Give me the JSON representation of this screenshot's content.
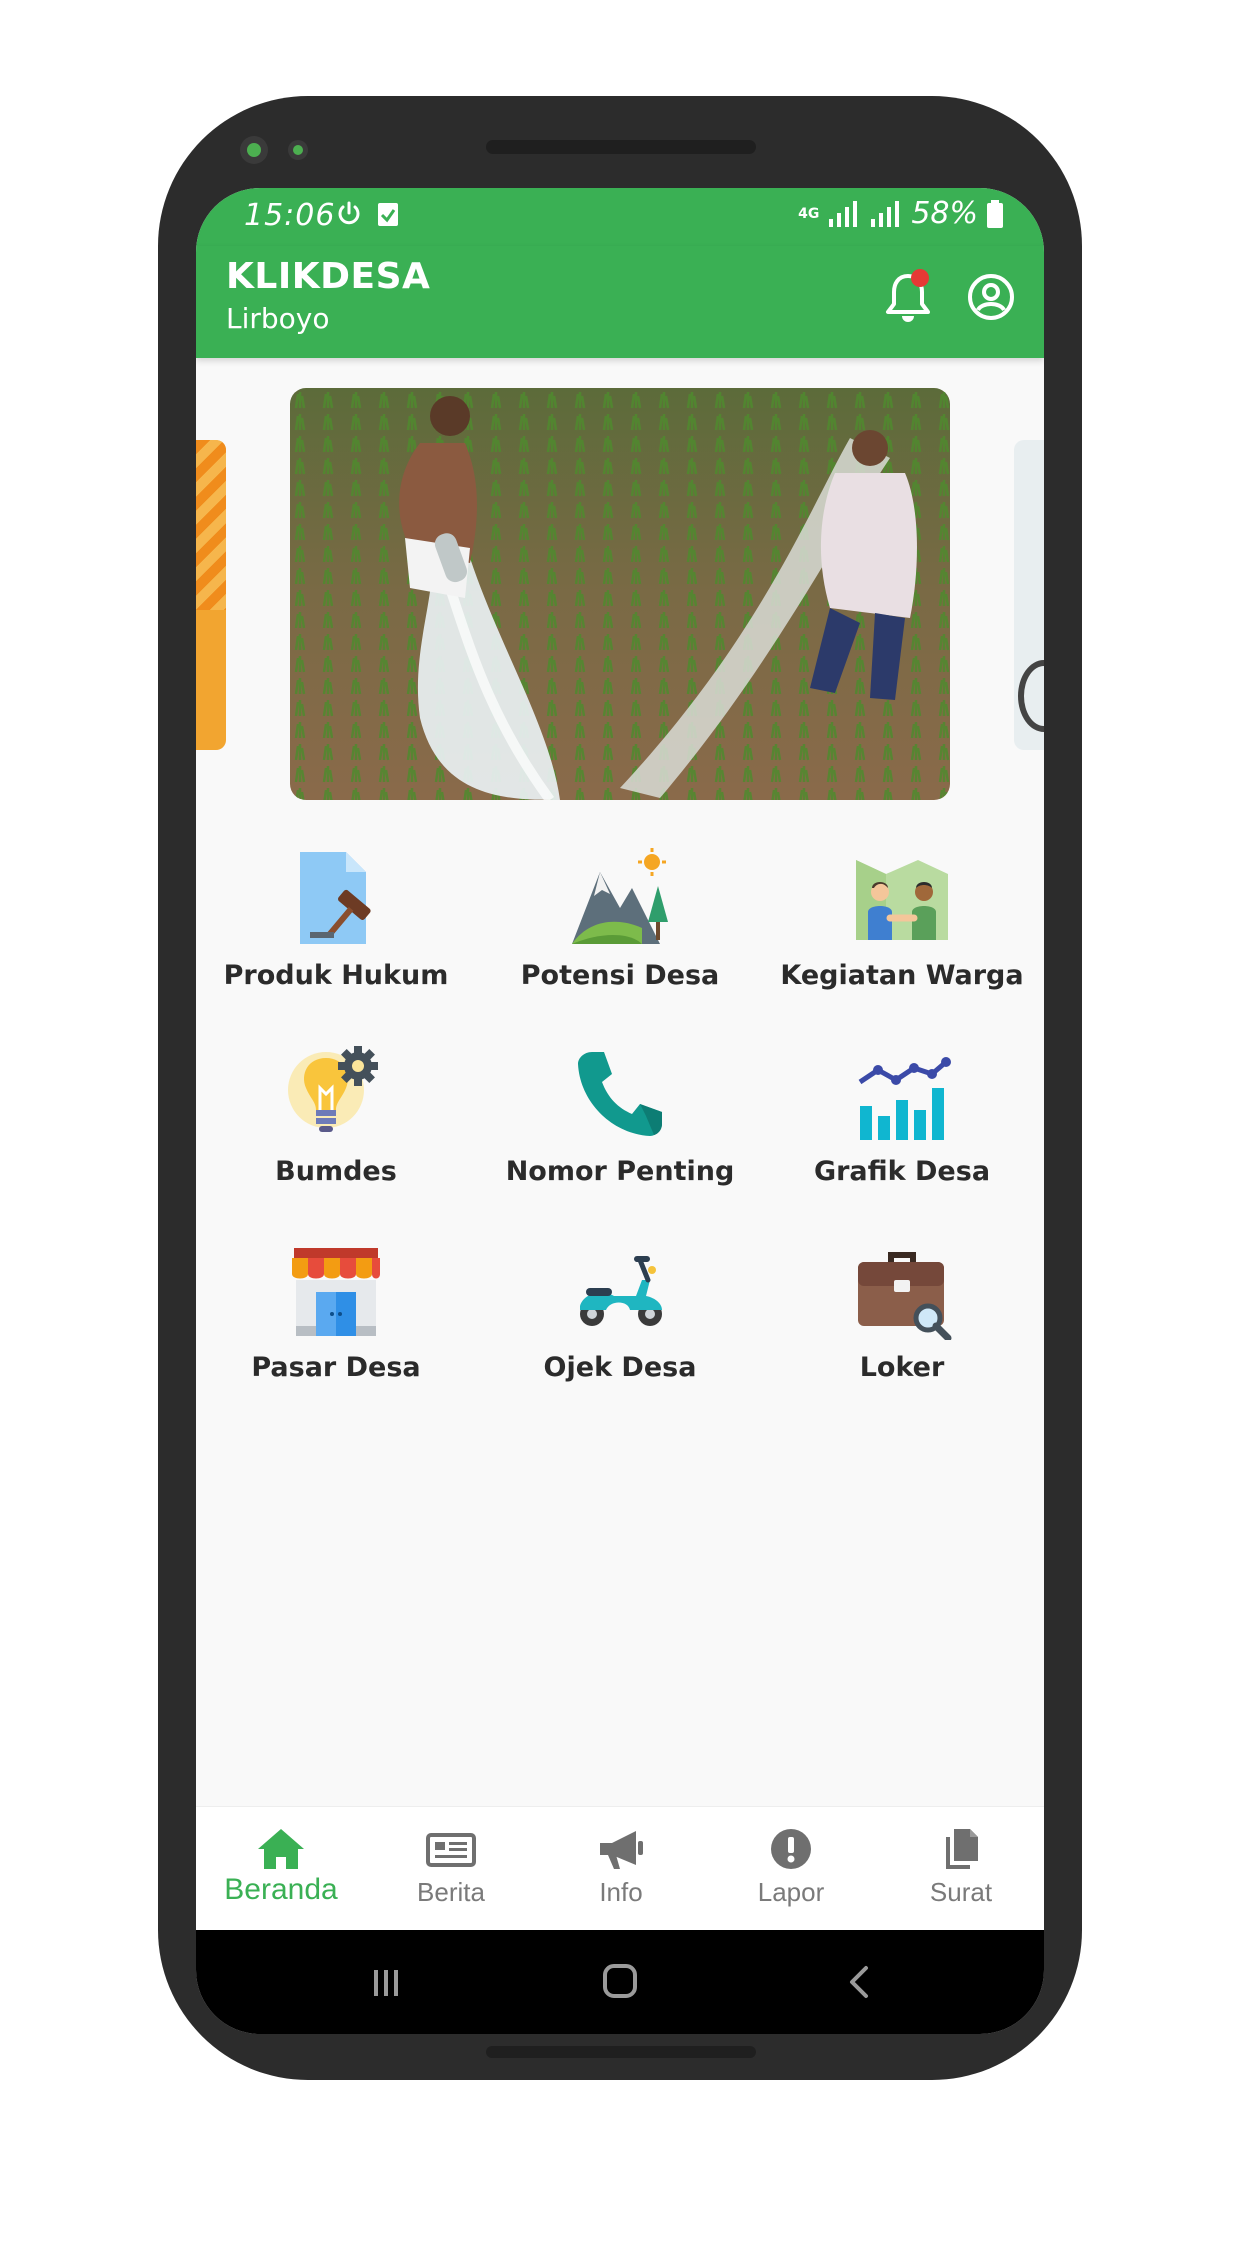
{
  "status_bar": {
    "time": "15:06",
    "network": "4G",
    "battery": "58%"
  },
  "app_bar": {
    "title": "KLIKDESA",
    "subtitle": "Lirboyo"
  },
  "menu": [
    {
      "label": "Produk Hukum",
      "icon": "law-document-icon"
    },
    {
      "label": "Potensi Desa",
      "icon": "mountain-landscape-icon"
    },
    {
      "label": "Kegiatan Warga",
      "icon": "people-handshake-icon"
    },
    {
      "label": "Bumdes",
      "icon": "lightbulb-gear-icon"
    },
    {
      "label": "Nomor Penting",
      "icon": "phone-icon"
    },
    {
      "label": "Grafik Desa",
      "icon": "bar-chart-icon"
    },
    {
      "label": "Pasar Desa",
      "icon": "market-stall-icon"
    },
    {
      "label": "Ojek Desa",
      "icon": "scooter-icon"
    },
    {
      "label": "Loker",
      "icon": "briefcase-search-icon"
    }
  ],
  "bottom_nav": [
    {
      "label": "Beranda",
      "icon": "home-icon",
      "active": true
    },
    {
      "label": "Berita",
      "icon": "newspaper-icon",
      "active": false
    },
    {
      "label": "Info",
      "icon": "megaphone-icon",
      "active": false
    },
    {
      "label": "Lapor",
      "icon": "alert-circle-icon",
      "active": false
    },
    {
      "label": "Surat",
      "icon": "documents-icon",
      "active": false
    }
  ],
  "colors": {
    "primary": "#3ab054",
    "nav_inactive": "#7a7a7a"
  }
}
